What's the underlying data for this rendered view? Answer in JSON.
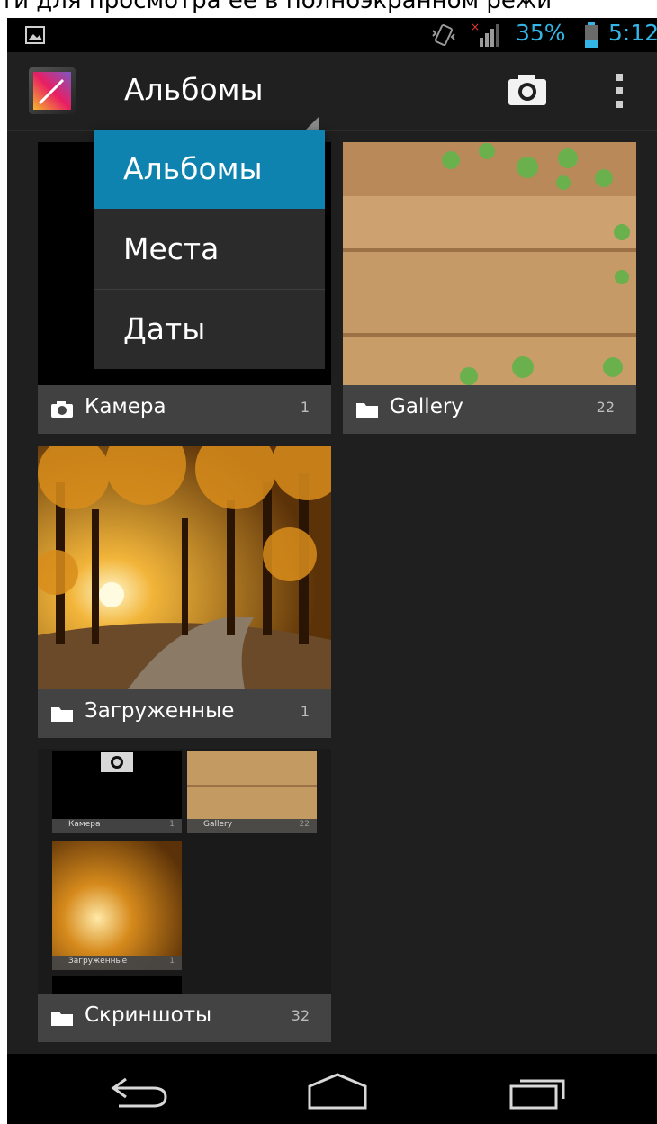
{
  "overlay_text": "ти для просмотра её в полноэкранном режи",
  "status_bar": {
    "battery": "35%",
    "time": "5:12"
  },
  "action_bar": {
    "title": "Альбомы"
  },
  "dropdown": {
    "items": [
      "Альбомы",
      "Места",
      "Даты"
    ],
    "selected": "Альбомы"
  },
  "albums": [
    {
      "name": "Камера",
      "count": "1"
    },
    {
      "name": "Gallery",
      "count": "22"
    },
    {
      "name": "Загруженные",
      "count": "1"
    },
    {
      "name": "Скриншоты",
      "count": "32"
    }
  ],
  "mini_albums": [
    {
      "name": "Камера",
      "count": "1"
    },
    {
      "name": "Gallery",
      "count": "22"
    },
    {
      "name": "Загруженные",
      "count": "1"
    }
  ],
  "colors": {
    "accent": "#33b5e5",
    "selected": "#0e83b0"
  }
}
